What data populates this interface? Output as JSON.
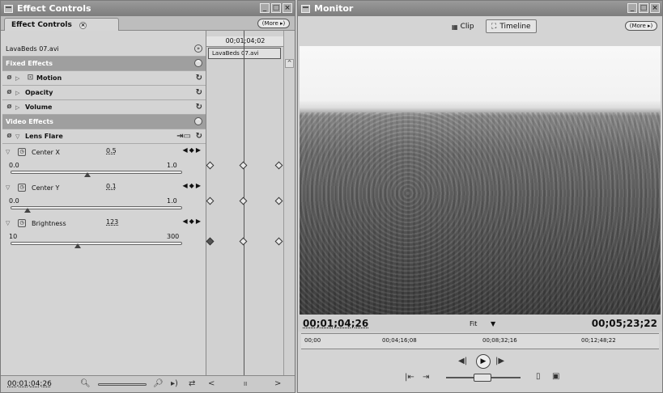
{
  "effect_controls": {
    "title": "Effect Controls",
    "tab_label": "Effect Controls",
    "tab_close": "×",
    "more_label": "(More ▸)",
    "clip_name": "LavaBeds 07.avi",
    "timecode_head": "00;01;04;02",
    "clip_bar_label": "LavaBeds 07.avi",
    "fixed_effects_label": "Fixed Effects",
    "video_effects_label": "Video Effects",
    "fixed": [
      {
        "label": "Motion"
      },
      {
        "label": "Opacity"
      },
      {
        "label": "Volume"
      }
    ],
    "lens_flare": {
      "label": "Lens Flare",
      "params": [
        {
          "label": "Center X",
          "value": "0.5",
          "min": "0.0",
          "max": "1.0",
          "level": 0.45
        },
        {
          "label": "Center Y",
          "value": "0.1",
          "min": "0.0",
          "max": "1.0",
          "level": 0.1
        },
        {
          "label": "Brightness",
          "value": "123",
          "min": "10",
          "max": "300",
          "level": 0.39
        }
      ]
    },
    "footer_timecode": "00;01;04;26",
    "scroll_mid": "II"
  },
  "monitor": {
    "title": "Monitor",
    "more_label": "(More ▸)",
    "clip_label": "Clip",
    "timeline_label": "Timeline",
    "timecode_left": "00;01;04;26",
    "fit_label": "Fit",
    "timecode_right": "00;05;23;22",
    "ruler": [
      "00;00",
      "00;04;16;08",
      "00;08;32;16",
      "00;12;48;22"
    ]
  },
  "colors": {
    "panel": "#d4d4d4",
    "header": "#9f9f9f",
    "titlebar": "#8a8a8a"
  }
}
